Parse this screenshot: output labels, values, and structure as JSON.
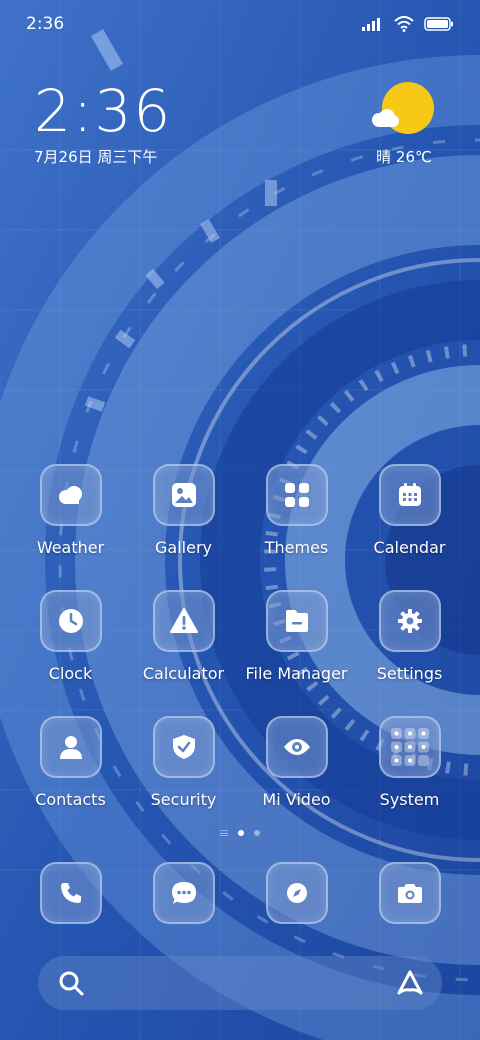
{
  "status_bar": {
    "time": "2:36"
  },
  "clock_widget": {
    "time": "2:36",
    "date": "7月26日 周三下午"
  },
  "weather_widget": {
    "text": "晴 26℃"
  },
  "apps": [
    {
      "label": "Weather",
      "icon": "weather-cloud-icon"
    },
    {
      "label": "Gallery",
      "icon": "gallery-icon"
    },
    {
      "label": "Themes",
      "icon": "themes-grid-icon"
    },
    {
      "label": "Calendar",
      "icon": "calendar-icon"
    },
    {
      "label": "Clock",
      "icon": "clock-icon"
    },
    {
      "label": "Calculator",
      "icon": "warning-triangle-icon"
    },
    {
      "label": "File Manager",
      "icon": "folder-icon"
    },
    {
      "label": "Settings",
      "icon": "gear-icon"
    },
    {
      "label": "Contacts",
      "icon": "person-icon"
    },
    {
      "label": "Security",
      "icon": "shield-icon"
    },
    {
      "label": "Mi Video",
      "icon": "eye-icon"
    },
    {
      "label": "System",
      "icon": "folder-grid-icon"
    }
  ],
  "dock": [
    {
      "icon": "phone-icon"
    },
    {
      "icon": "message-icon"
    },
    {
      "icon": "compass-icon"
    },
    {
      "icon": "camera-icon"
    }
  ],
  "colors": {
    "sun": "#f6c817",
    "wallpaper": "#1f4ea8"
  }
}
